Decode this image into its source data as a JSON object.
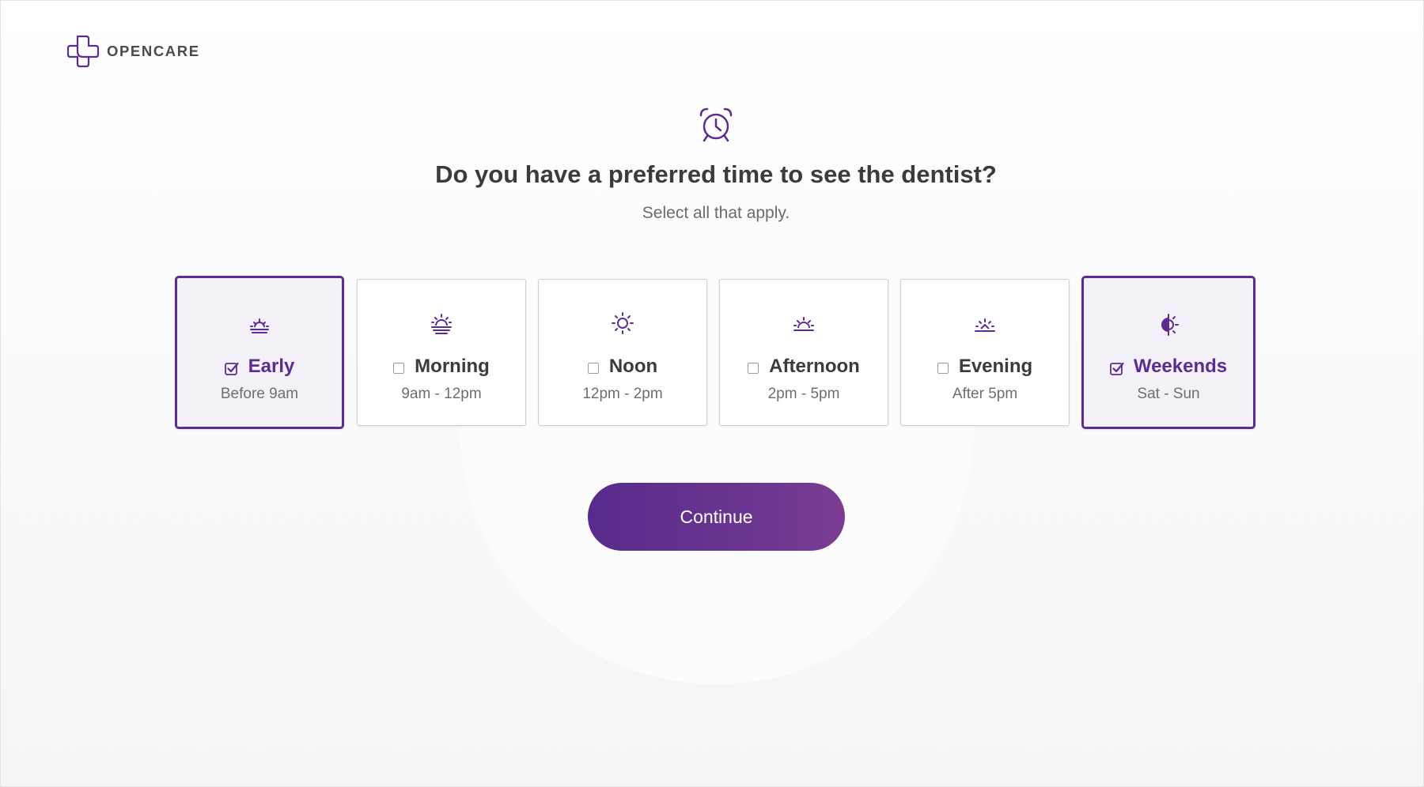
{
  "brand": {
    "name": "OPENCARE",
    "accent_color": "#5b2c91"
  },
  "header_icon": "alarm-clock-icon",
  "question": "Do you have a preferred time to see the dentist?",
  "subtitle": "Select all that apply.",
  "options": [
    {
      "label": "Early",
      "sublabel": "Before 9am",
      "selected": true,
      "icon": "sunrise-icon"
    },
    {
      "label": "Morning",
      "sublabel": "9am - 12pm",
      "selected": false,
      "icon": "rising-sun-icon"
    },
    {
      "label": "Noon",
      "sublabel": "12pm - 2pm",
      "selected": false,
      "icon": "sun-icon"
    },
    {
      "label": "Afternoon",
      "sublabel": "2pm - 5pm",
      "selected": false,
      "icon": "setting-sun-icon"
    },
    {
      "label": "Evening",
      "sublabel": "After 5pm",
      "selected": false,
      "icon": "sunset-icon"
    },
    {
      "label": "Weekends",
      "sublabel": "Sat - Sun",
      "selected": true,
      "icon": "half-sun-icon"
    }
  ],
  "continue_label": "Continue"
}
